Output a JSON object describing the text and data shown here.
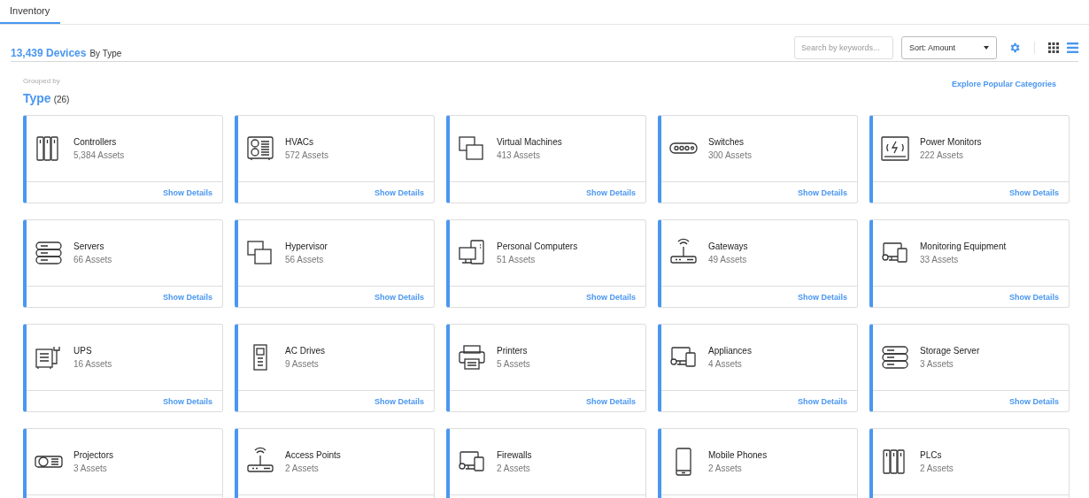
{
  "tabs": [
    {
      "label": "Inventory",
      "selected": true
    }
  ],
  "header": {
    "count": "13,439 Devices",
    "suffix": "By Type"
  },
  "toolbar": {
    "search": {
      "placeholder": "Search by keywords..."
    },
    "sort": {
      "value": "Sort: Amount"
    },
    "view_toggle": [
      {
        "kind": "grid",
        "selected": false
      },
      {
        "kind": "list",
        "selected": true
      }
    ]
  },
  "group": {
    "caption": "Grouped by",
    "name": "Type",
    "count": "(26)",
    "link": "Explore Popular Categories"
  },
  "cards": [
    {
      "kind": "controller",
      "name": "Controllers",
      "assets": "5,384 Assets",
      "link": "Show Details"
    },
    {
      "kind": "hvac",
      "name": "HVACs",
      "assets": "572 Assets",
      "link": "Show Details"
    },
    {
      "kind": "vm",
      "name": "Virtual Machines",
      "assets": "413 Assets",
      "link": "Show Details"
    },
    {
      "kind": "switch",
      "name": "Switches",
      "assets": "300 Assets",
      "link": "Show Details"
    },
    {
      "kind": "power",
      "name": "Power Monitors",
      "assets": "222 Assets",
      "link": "Show Details"
    },
    {
      "kind": "server",
      "name": "Servers",
      "assets": "66 Assets",
      "link": "Show Details"
    },
    {
      "kind": "vm",
      "name": "Hypervisor",
      "assets": "56 Assets",
      "link": "Show Details"
    },
    {
      "kind": "pc",
      "name": "Personal Computers",
      "assets": "51 Assets",
      "link": "Show Details"
    },
    {
      "kind": "gateway",
      "name": "Gateways",
      "assets": "49 Assets",
      "link": "Show Details"
    },
    {
      "kind": "devices",
      "name": "Monitoring Equipment",
      "assets": "33 Assets",
      "link": "Show Details"
    },
    {
      "kind": "ups",
      "name": "UPS",
      "assets": "16 Assets",
      "link": "Show Details"
    },
    {
      "kind": "drive",
      "name": "AC Drives",
      "assets": "9 Assets",
      "link": "Show Details"
    },
    {
      "kind": "printer",
      "name": "Printers",
      "assets": "5 Assets",
      "link": "Show Details"
    },
    {
      "kind": "devices",
      "name": "Appliances",
      "assets": "4 Assets",
      "link": "Show Details"
    },
    {
      "kind": "server",
      "name": "Storage Server",
      "assets": "3 Assets",
      "link": "Show Details"
    },
    {
      "kind": "projector",
      "name": "Projectors",
      "assets": "3 Assets"
    },
    {
      "kind": "gateway",
      "name": "Access Points",
      "assets": "2 Assets"
    },
    {
      "kind": "devices",
      "name": "Firewalls",
      "assets": "2 Assets"
    },
    {
      "kind": "phone",
      "name": "Mobile Phones",
      "assets": "2 Assets"
    },
    {
      "kind": "controller",
      "name": "PLCs",
      "assets": "2 Assets"
    }
  ]
}
